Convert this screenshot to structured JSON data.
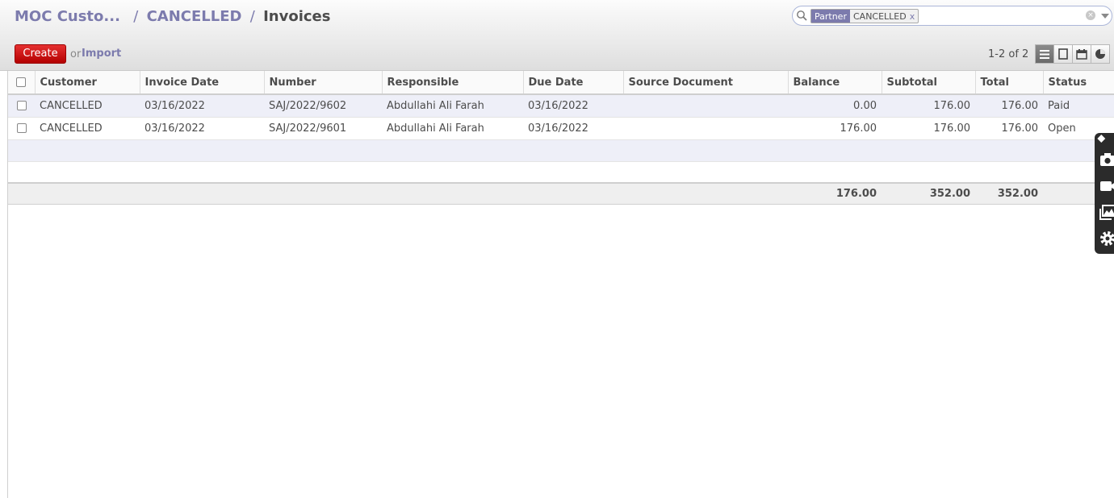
{
  "breadcrumb": {
    "item1": "MOC Custo...",
    "sep1": "/",
    "item2": "CANCELLED",
    "sep2": "/",
    "current": "Invoices"
  },
  "search": {
    "facet_category": "Partner",
    "facet_value": "CANCELLED",
    "facet_remove": "x",
    "value": ""
  },
  "toolbar": {
    "create_label": "Create",
    "or_label": "or",
    "import_label": "Import",
    "pager": "1-2 of 2"
  },
  "views": [
    "list-view-icon",
    "form-view-icon",
    "calendar-view-icon",
    "graph-view-icon"
  ],
  "table": {
    "columns": [
      "Customer",
      "Invoice Date",
      "Number",
      "Responsible",
      "Due Date",
      "Source Document",
      "Balance",
      "Subtotal",
      "Total",
      "Status"
    ],
    "rows": [
      {
        "customer": "CANCELLED",
        "invoice_date": "03/16/2022",
        "number": "SAJ/2022/9602",
        "responsible": "Abdullahi Ali Farah",
        "due_date": "03/16/2022",
        "source": "",
        "balance": "0.00",
        "subtotal": "176.00",
        "total": "176.00",
        "status": "Paid"
      },
      {
        "customer": "CANCELLED",
        "invoice_date": "03/16/2022",
        "number": "SAJ/2022/9601",
        "responsible": "Abdullahi Ali Farah",
        "due_date": "03/16/2022",
        "source": "",
        "balance": "176.00",
        "subtotal": "176.00",
        "total": "176.00",
        "status": "Open"
      }
    ],
    "totals": {
      "balance": "176.00",
      "subtotal": "352.00",
      "total": "352.00"
    }
  },
  "colors": {
    "accent": "#7c7bad",
    "create": "#d01c1c"
  }
}
